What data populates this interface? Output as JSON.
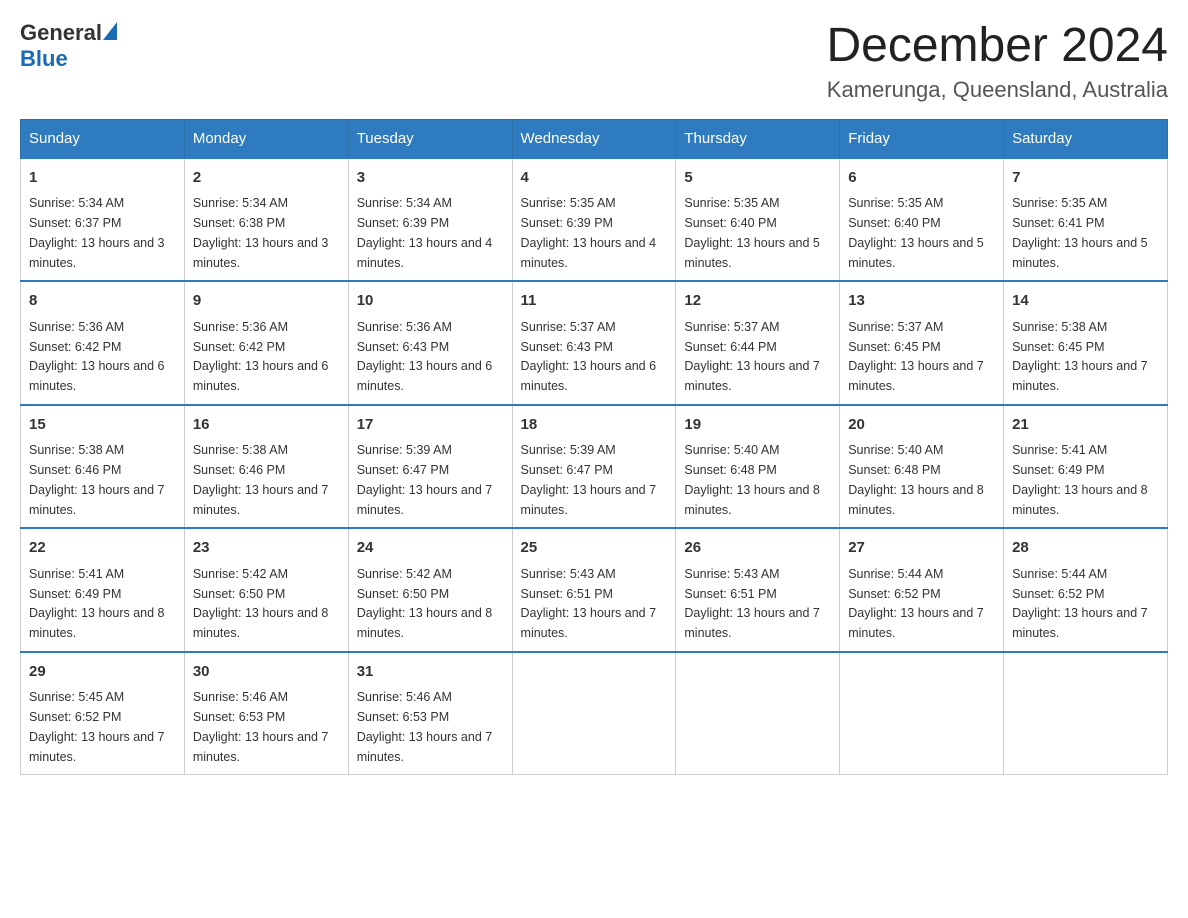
{
  "logo": {
    "general": "General",
    "blue": "Blue"
  },
  "title": "December 2024",
  "location": "Kamerunga, Queensland, Australia",
  "days_of_week": [
    "Sunday",
    "Monday",
    "Tuesday",
    "Wednesday",
    "Thursday",
    "Friday",
    "Saturday"
  ],
  "weeks": [
    [
      {
        "day": "1",
        "sunrise": "5:34 AM",
        "sunset": "6:37 PM",
        "daylight": "13 hours and 3 minutes."
      },
      {
        "day": "2",
        "sunrise": "5:34 AM",
        "sunset": "6:38 PM",
        "daylight": "13 hours and 3 minutes."
      },
      {
        "day": "3",
        "sunrise": "5:34 AM",
        "sunset": "6:39 PM",
        "daylight": "13 hours and 4 minutes."
      },
      {
        "day": "4",
        "sunrise": "5:35 AM",
        "sunset": "6:39 PM",
        "daylight": "13 hours and 4 minutes."
      },
      {
        "day": "5",
        "sunrise": "5:35 AM",
        "sunset": "6:40 PM",
        "daylight": "13 hours and 5 minutes."
      },
      {
        "day": "6",
        "sunrise": "5:35 AM",
        "sunset": "6:40 PM",
        "daylight": "13 hours and 5 minutes."
      },
      {
        "day": "7",
        "sunrise": "5:35 AM",
        "sunset": "6:41 PM",
        "daylight": "13 hours and 5 minutes."
      }
    ],
    [
      {
        "day": "8",
        "sunrise": "5:36 AM",
        "sunset": "6:42 PM",
        "daylight": "13 hours and 6 minutes."
      },
      {
        "day": "9",
        "sunrise": "5:36 AM",
        "sunset": "6:42 PM",
        "daylight": "13 hours and 6 minutes."
      },
      {
        "day": "10",
        "sunrise": "5:36 AM",
        "sunset": "6:43 PM",
        "daylight": "13 hours and 6 minutes."
      },
      {
        "day": "11",
        "sunrise": "5:37 AM",
        "sunset": "6:43 PM",
        "daylight": "13 hours and 6 minutes."
      },
      {
        "day": "12",
        "sunrise": "5:37 AM",
        "sunset": "6:44 PM",
        "daylight": "13 hours and 7 minutes."
      },
      {
        "day": "13",
        "sunrise": "5:37 AM",
        "sunset": "6:45 PM",
        "daylight": "13 hours and 7 minutes."
      },
      {
        "day": "14",
        "sunrise": "5:38 AM",
        "sunset": "6:45 PM",
        "daylight": "13 hours and 7 minutes."
      }
    ],
    [
      {
        "day": "15",
        "sunrise": "5:38 AM",
        "sunset": "6:46 PM",
        "daylight": "13 hours and 7 minutes."
      },
      {
        "day": "16",
        "sunrise": "5:38 AM",
        "sunset": "6:46 PM",
        "daylight": "13 hours and 7 minutes."
      },
      {
        "day": "17",
        "sunrise": "5:39 AM",
        "sunset": "6:47 PM",
        "daylight": "13 hours and 7 minutes."
      },
      {
        "day": "18",
        "sunrise": "5:39 AM",
        "sunset": "6:47 PM",
        "daylight": "13 hours and 7 minutes."
      },
      {
        "day": "19",
        "sunrise": "5:40 AM",
        "sunset": "6:48 PM",
        "daylight": "13 hours and 8 minutes."
      },
      {
        "day": "20",
        "sunrise": "5:40 AM",
        "sunset": "6:48 PM",
        "daylight": "13 hours and 8 minutes."
      },
      {
        "day": "21",
        "sunrise": "5:41 AM",
        "sunset": "6:49 PM",
        "daylight": "13 hours and 8 minutes."
      }
    ],
    [
      {
        "day": "22",
        "sunrise": "5:41 AM",
        "sunset": "6:49 PM",
        "daylight": "13 hours and 8 minutes."
      },
      {
        "day": "23",
        "sunrise": "5:42 AM",
        "sunset": "6:50 PM",
        "daylight": "13 hours and 8 minutes."
      },
      {
        "day": "24",
        "sunrise": "5:42 AM",
        "sunset": "6:50 PM",
        "daylight": "13 hours and 8 minutes."
      },
      {
        "day": "25",
        "sunrise": "5:43 AM",
        "sunset": "6:51 PM",
        "daylight": "13 hours and 7 minutes."
      },
      {
        "day": "26",
        "sunrise": "5:43 AM",
        "sunset": "6:51 PM",
        "daylight": "13 hours and 7 minutes."
      },
      {
        "day": "27",
        "sunrise": "5:44 AM",
        "sunset": "6:52 PM",
        "daylight": "13 hours and 7 minutes."
      },
      {
        "day": "28",
        "sunrise": "5:44 AM",
        "sunset": "6:52 PM",
        "daylight": "13 hours and 7 minutes."
      }
    ],
    [
      {
        "day": "29",
        "sunrise": "5:45 AM",
        "sunset": "6:52 PM",
        "daylight": "13 hours and 7 minutes."
      },
      {
        "day": "30",
        "sunrise": "5:46 AM",
        "sunset": "6:53 PM",
        "daylight": "13 hours and 7 minutes."
      },
      {
        "day": "31",
        "sunrise": "5:46 AM",
        "sunset": "6:53 PM",
        "daylight": "13 hours and 7 minutes."
      },
      null,
      null,
      null,
      null
    ]
  ]
}
